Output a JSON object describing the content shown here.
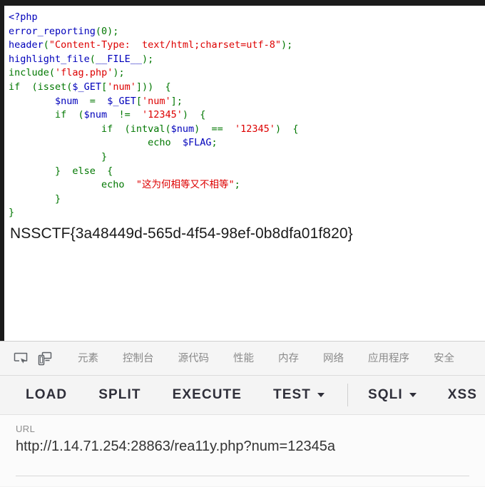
{
  "page": {
    "code_lines": [
      [
        {
          "t": "<?php",
          "c": "dflt"
        }
      ],
      [
        {
          "t": "error_reporting",
          "c": "dflt"
        },
        {
          "t": "(0);",
          "c": "kw"
        }
      ],
      [
        {
          "t": "header",
          "c": "dflt"
        },
        {
          "t": "(",
          "c": "kw"
        },
        {
          "t": "\"Content-Type:  text/html;charset=utf-8\"",
          "c": "str"
        },
        {
          "t": ");",
          "c": "kw"
        }
      ],
      [
        {
          "t": "highlight_file",
          "c": "dflt"
        },
        {
          "t": "(",
          "c": "kw"
        },
        {
          "t": "__FILE__",
          "c": "dflt"
        },
        {
          "t": ");",
          "c": "kw"
        }
      ],
      [
        {
          "t": "include",
          "c": "kw"
        },
        {
          "t": "(",
          "c": "kw"
        },
        {
          "t": "'flag.php'",
          "c": "str"
        },
        {
          "t": ");",
          "c": "kw"
        }
      ],
      [
        {
          "t": "if  (",
          "c": "kw"
        },
        {
          "t": "isset",
          "c": "kw"
        },
        {
          "t": "(",
          "c": "kw"
        },
        {
          "t": "$_GET",
          "c": "dflt"
        },
        {
          "t": "[",
          "c": "kw"
        },
        {
          "t": "'num'",
          "c": "str"
        },
        {
          "t": "]))  {",
          "c": "kw"
        }
      ],
      [
        {
          "t": "        ",
          "c": "kw"
        },
        {
          "t": "$num",
          "c": "dflt"
        },
        {
          "t": "  =  ",
          "c": "kw"
        },
        {
          "t": "$_GET",
          "c": "dflt"
        },
        {
          "t": "[",
          "c": "kw"
        },
        {
          "t": "'num'",
          "c": "str"
        },
        {
          "t": "];",
          "c": "kw"
        }
      ],
      [
        {
          "t": "        if  (",
          "c": "kw"
        },
        {
          "t": "$num",
          "c": "dflt"
        },
        {
          "t": "  !=  ",
          "c": "kw"
        },
        {
          "t": "'12345'",
          "c": "str"
        },
        {
          "t": ")  {",
          "c": "kw"
        }
      ],
      [
        {
          "t": "                if  (",
          "c": "kw"
        },
        {
          "t": "intval",
          "c": "kw"
        },
        {
          "t": "(",
          "c": "kw"
        },
        {
          "t": "$num",
          "c": "dflt"
        },
        {
          "t": ")  ==  ",
          "c": "kw"
        },
        {
          "t": "'12345'",
          "c": "str"
        },
        {
          "t": ")  {",
          "c": "kw"
        }
      ],
      [
        {
          "t": "                        echo  ",
          "c": "kw"
        },
        {
          "t": "$FLAG",
          "c": "dflt"
        },
        {
          "t": ";",
          "c": "kw"
        }
      ],
      [
        {
          "t": "                }",
          "c": "kw"
        }
      ],
      [
        {
          "t": "        }  else  {",
          "c": "kw"
        }
      ],
      [
        {
          "t": "                echo  ",
          "c": "kw"
        },
        {
          "t": "\"这为何相等又不相等\"",
          "c": "str"
        },
        {
          "t": ";",
          "c": "kw"
        }
      ],
      [
        {
          "t": "        }",
          "c": "kw"
        }
      ],
      [
        {
          "t": "}",
          "c": "kw"
        }
      ]
    ],
    "flag_text": "NSSCTF{3a48449d-565d-4f54-98ef-0b8dfa01f820}"
  },
  "devtools": {
    "icons": [
      {
        "name": "inspect-element-icon"
      },
      {
        "name": "device-toolbar-icon"
      }
    ],
    "tabs": [
      {
        "label": "元素",
        "name": "tab-elements"
      },
      {
        "label": "控制台",
        "name": "tab-console"
      },
      {
        "label": "源代码",
        "name": "tab-sources"
      },
      {
        "label": "性能",
        "name": "tab-performance"
      },
      {
        "label": "内存",
        "name": "tab-memory"
      },
      {
        "label": "网络",
        "name": "tab-network"
      },
      {
        "label": "应用程序",
        "name": "tab-application"
      },
      {
        "label": "安全",
        "name": "tab-security"
      }
    ]
  },
  "hackbar": {
    "buttons": [
      {
        "label": "LOAD",
        "name": "load-button",
        "caret": false,
        "sep_after": false
      },
      {
        "label": "SPLIT",
        "name": "split-button",
        "caret": false,
        "sep_after": false
      },
      {
        "label": "EXECUTE",
        "name": "execute-button",
        "caret": false,
        "sep_after": false
      },
      {
        "label": "TEST",
        "name": "test-button",
        "caret": true,
        "sep_after": true
      },
      {
        "label": "SQLI",
        "name": "sqli-button",
        "caret": true,
        "sep_after": false
      },
      {
        "label": "XSS",
        "name": "xss-button",
        "caret": false,
        "sep_after": false
      }
    ],
    "url_label": "URL",
    "url_value": "http://1.14.71.254:28863/rea11y.php?num=12345a"
  },
  "colors": {
    "php_default": "#0000bb",
    "php_keyword": "#007700",
    "php_string": "#dd0000",
    "chrome_bar": "#1b1b1b",
    "devtools_bg": "#f2f2f2",
    "hackbar_text": "#2f2f3a"
  }
}
